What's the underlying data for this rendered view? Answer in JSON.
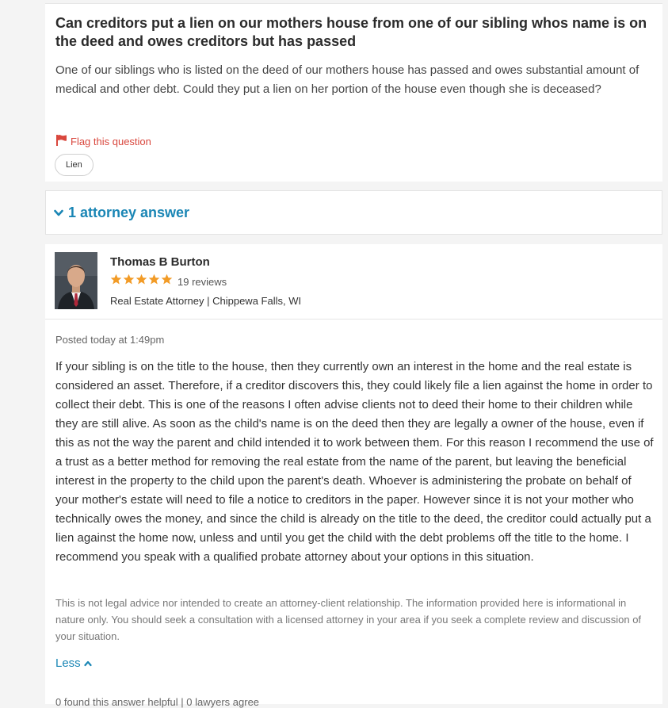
{
  "question": {
    "title": "Can creditors put a lien on our mothers house from one of our sibling whos name is on the deed and owes creditors but has passed",
    "body": "One of our siblings who is listed on the deed of our mothers house has passed and owes substantial amount of medical and other debt. Could they put a lien on her portion of the house even though she is deceased?",
    "flag_label": "Flag this question",
    "tag": "Lien"
  },
  "answers_header": {
    "label": "1 attorney answer"
  },
  "attorney": {
    "name": "Thomas B Burton",
    "rating_stars": 5,
    "reviews": "19 reviews",
    "meta": "Real Estate Attorney | Chippewa Falls, WI"
  },
  "answer": {
    "posted": "Posted today at 1:49pm",
    "body": "If your sibling is on the title to the house, then they currently own an interest in the home and the real estate is considered an asset. Therefore, if a creditor discovers this, they could likely file a lien against the home in order to collect their debt. This is one of the reasons I often advise clients not to deed their home to their children while they are still alive. As soon as the child's name is on the deed then they are legally a owner of the house, even if this as not the way the parent and child intended it to work between them. For this reason I recommend the use of a trust as a better method for removing the real estate from the name of the parent, but leaving the beneficial interest in the property to the child upon the parent's death. Whoever is administering the probate on behalf of your mother's estate will need to file a notice to creditors in the paper. However since it is not your mother who technically owes the money, and since the child is already on the title to the deed, the creditor could actually put a lien against the home now, unless and until you get the child with the debt problems off the title to the home. I recommend you speak with a qualified probate attorney about your options in this situation.",
    "disclaimer": "This is not legal advice nor intended to create an attorney-client relationship. The information provided here is informational in nature only. You should seek a consultation with a licensed attorney in your area if you seek a complete review and discussion of your situation.",
    "less_label": "Less",
    "helpful": "0 found this answer helpful | 0 lawyers agree"
  },
  "colors": {
    "accent": "#1a86b5",
    "flag": "#d9473d",
    "star": "#f29b26"
  },
  "icons": [
    "flag-icon",
    "chevron-down-icon",
    "star-icon",
    "chevron-up-icon"
  ]
}
